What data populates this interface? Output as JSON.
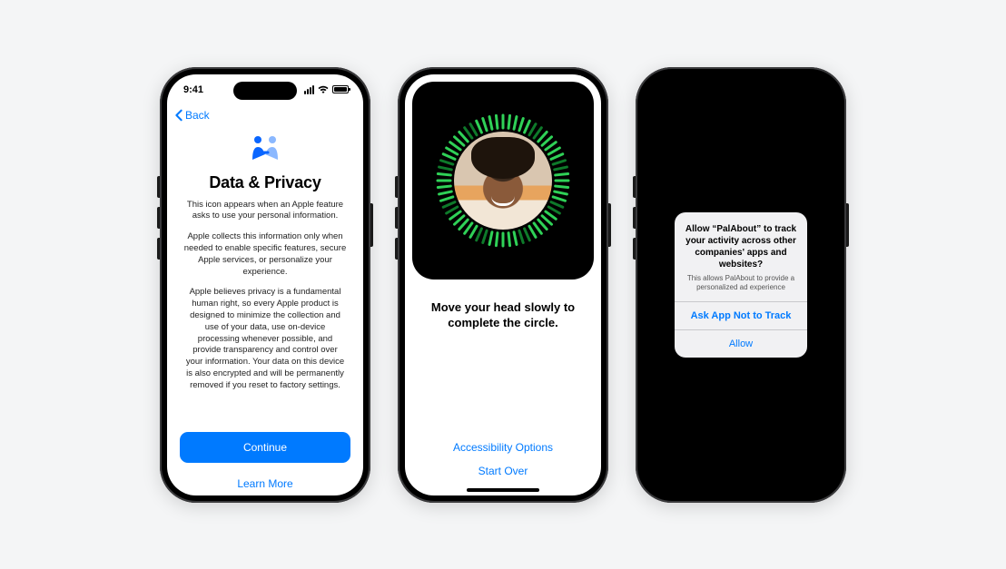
{
  "status": {
    "time": "9:41"
  },
  "phone1": {
    "back": "Back",
    "title": "Data & Privacy",
    "para1": "This icon appears when an Apple feature asks to use your personal information.",
    "para2": "Apple collects this information only when needed to enable specific features, secure Apple services, or personalize your experience.",
    "para3": "Apple believes privacy is a fundamental human right, so every Apple product is designed to minimize the collection and use of your data, use on-device processing whenever possible, and provide transparency and control over your information. Your data on this device is also encrypted and will be permanently removed if you reset to factory settings.",
    "continue": "Continue",
    "learn_more": "Learn More"
  },
  "phone2": {
    "instruction": "Move your head slowly to complete the circle.",
    "accessibility": "Accessibility Options",
    "start_over": "Start Over"
  },
  "phone3": {
    "alert_title": "Allow “PalAbout” to track your activity across other companies' apps and websites?",
    "alert_sub": "This allows PalAbout to provide a personalized ad experience",
    "deny": "Ask App Not to Track",
    "allow": "Allow"
  }
}
